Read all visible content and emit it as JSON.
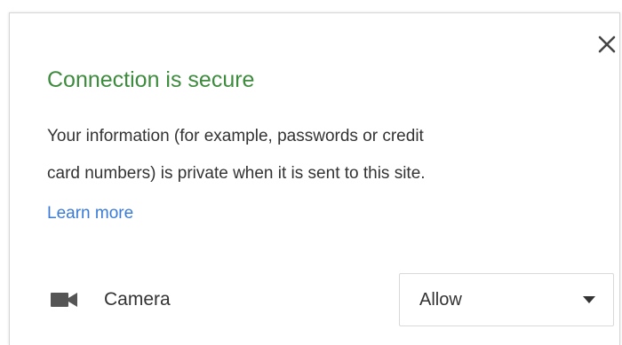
{
  "dialog": {
    "title": "Connection is secure",
    "description_lines": [
      "Your information (for example, passwords or credit",
      "card numbers) is private when it is sent to this site."
    ],
    "learn_more": "Learn more",
    "close_icon": "close-icon"
  },
  "permissions": [
    {
      "icon": "camera-icon",
      "label": "Camera",
      "value": "Allow",
      "dropdown_icon": "caret-down-icon"
    }
  ],
  "colors": {
    "title": "#3d8b3d",
    "link": "#3a7bd5",
    "text": "#333333"
  }
}
